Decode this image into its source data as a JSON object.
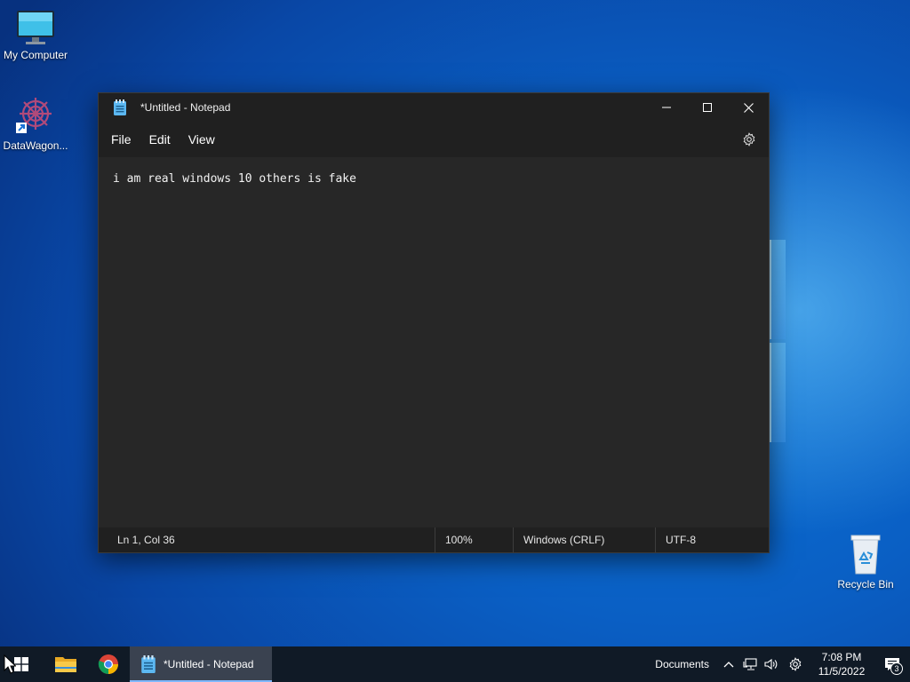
{
  "desktop": {
    "icons": [
      {
        "label": "My Computer"
      },
      {
        "label": "DataWagon..."
      },
      {
        "label": "Recycle Bin"
      }
    ]
  },
  "notepad": {
    "title": "*Untitled - Notepad",
    "menu": {
      "file": "File",
      "edit": "Edit",
      "view": "View"
    },
    "content": "i am real windows 10 others is fake",
    "status": {
      "position": "Ln 1, Col 36",
      "zoom": "100%",
      "line_ending": "Windows (CRLF)",
      "encoding": "UTF-8"
    }
  },
  "taskbar": {
    "active_app_label": "*Untitled - Notepad",
    "tray": {
      "documents_label": "Documents",
      "time": "7:08 PM",
      "date": "11/5/2022",
      "notification_count": "3"
    }
  },
  "colors": {
    "window_bg": "#272727",
    "titlebar_bg": "#202020",
    "taskbar_bg": "#101a26",
    "accent": "#7fb8ff"
  }
}
